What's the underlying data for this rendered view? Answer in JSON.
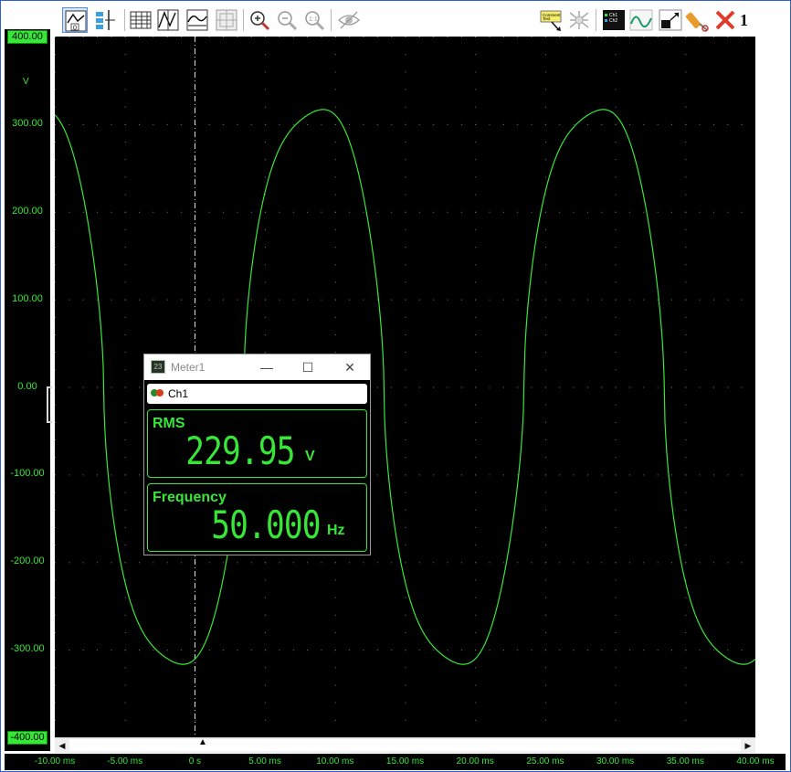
{
  "toolbar": {
    "count": "1",
    "buttons": [
      {
        "name": "channel-zero-icon",
        "icon": "zero-line"
      },
      {
        "name": "cursor-bars-icon",
        "icon": "cursor"
      },
      {
        "name": "table-view-icon",
        "icon": "table"
      },
      {
        "name": "peak-view-icon",
        "icon": "peak"
      },
      {
        "name": "wave-view-icon",
        "icon": "wave"
      },
      {
        "name": "grid-view-icon",
        "icon": "grid"
      },
      {
        "name": "zoom-in-icon",
        "icon": "zoom-in"
      },
      {
        "name": "zoom-out-icon",
        "icon": "zoom-out"
      },
      {
        "name": "zoom-fit-icon",
        "icon": "zoom-fit"
      },
      {
        "name": "eye-icon",
        "icon": "eye"
      },
      {
        "name": "comment-icon",
        "icon": "comment"
      },
      {
        "name": "network-icon",
        "icon": "network"
      },
      {
        "name": "channels-icon",
        "icon": "channels"
      },
      {
        "name": "oscilloscope-icon",
        "icon": "scope"
      },
      {
        "name": "resize-icon",
        "icon": "resize"
      },
      {
        "name": "probe-icon",
        "icon": "probe"
      },
      {
        "name": "close-icon",
        "icon": "close"
      }
    ]
  },
  "y_axis": {
    "unit": "V",
    "labels": [
      "400.00",
      "300.00",
      "200.00",
      "100.00",
      "0.00",
      "-100.00",
      "-200.00",
      "-300.00",
      "-400.00"
    ],
    "highlighted": [
      "400.00",
      "-400.00"
    ]
  },
  "x_axis": {
    "labels": [
      "-10.00 ms",
      "-5.00 ms",
      "0 s",
      "5.00 ms",
      "10.00 ms",
      "15.00 ms",
      "20.00 ms",
      "25.00 ms",
      "30.00 ms",
      "35.00 ms",
      "40.00 ms"
    ]
  },
  "colors": {
    "trace": "#37e737",
    "grid_dots": "#7a7a7a",
    "plot_background": "#000000",
    "cursor_line": "#e8e8e8"
  },
  "waveform": {
    "frequency_hz": 50,
    "peak_v": 325,
    "cursor_ms": 0
  },
  "meter": {
    "title": "Meter1",
    "window_controls": {
      "minimize": "—",
      "maximize": "☐",
      "close": "✕"
    },
    "channel": "Ch1",
    "channel_dot_colors": [
      "#2a8a2a",
      "#d83a1a"
    ],
    "rms": {
      "label": "RMS",
      "value": "229.95",
      "unit": "V"
    },
    "frequency": {
      "label": "Frequency",
      "value": "50.000",
      "unit": "Hz"
    }
  },
  "scrollbar": {
    "left_arrow": "◀",
    "right_arrow": "▶",
    "position_marker": "▲"
  }
}
